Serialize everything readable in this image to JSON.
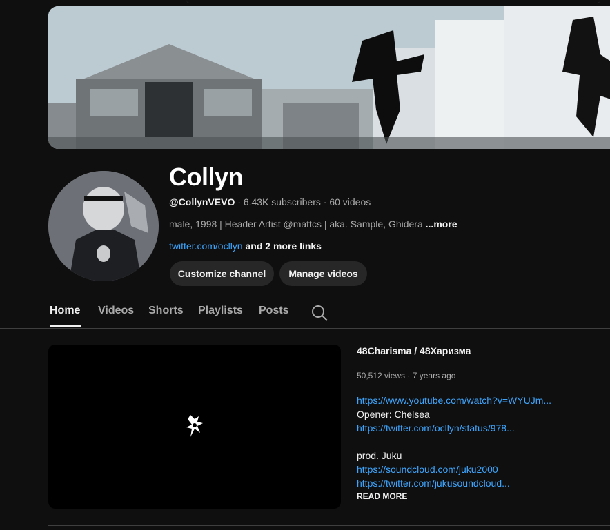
{
  "channel": {
    "name": "Collyn",
    "handle": "@CollynVEVO",
    "subscribers": "6.43K subscribers",
    "videos_count": "60 videos",
    "separator": " · ",
    "description": "male, 1998 | Header Artist @mattcs | aka. Sample, Ghidera",
    "more_label": "...more",
    "link_text": "twitter.com/ocllyn",
    "more_links_text": "and 2 more links"
  },
  "buttons": {
    "customize": "Customize channel",
    "manage": "Manage videos"
  },
  "tabs": [
    {
      "label": "Home",
      "active": true
    },
    {
      "label": "Videos",
      "active": false
    },
    {
      "label": "Shorts",
      "active": false
    },
    {
      "label": "Playlists",
      "active": false
    },
    {
      "label": "Posts",
      "active": false
    }
  ],
  "featured": {
    "title": "48Charisma / 48Харизма",
    "views": "50,512 views",
    "age": "7 years ago",
    "description_lines": [
      {
        "text": "https://www.youtube.com/watch?v=WYUJm...",
        "link": true
      },
      {
        "text": "Opener: Chelsea",
        "link": false
      },
      {
        "text": "https://twitter.com/ocllyn/status/978...",
        "link": true
      },
      {
        "text": "",
        "link": false
      },
      {
        "text": "prod. Juku",
        "link": false
      },
      {
        "text": "https://soundcloud.com/juku2000",
        "link": true
      },
      {
        "text": "https://twitter.com/jukusoundcloud...",
        "link": true
      }
    ],
    "read_more": "READ MORE"
  },
  "icons": {
    "search": "search-icon",
    "player_logo": "channel-logo-icon"
  },
  "colors": {
    "background": "#0f0f0f",
    "link": "#3ea6ff",
    "button_bg": "#272727",
    "secondary_text": "#aaaaaa"
  }
}
